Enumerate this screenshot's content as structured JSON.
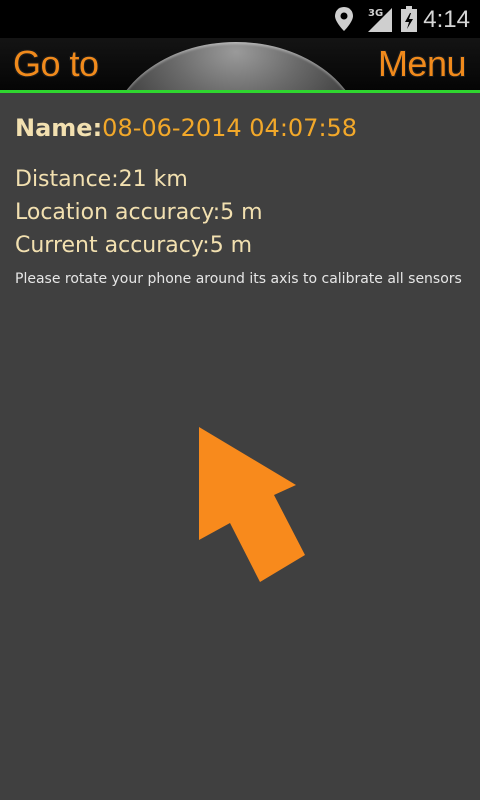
{
  "status_bar": {
    "time": "4:14",
    "network_label": "3G",
    "icons": [
      "location-icon",
      "signal-icon",
      "battery-icon"
    ]
  },
  "action_bar": {
    "goto_label": "Go to",
    "menu_label": "Menu"
  },
  "info": {
    "name_label": "Name:",
    "name_value": "08-06-2014 04:07:58",
    "distance": "Distance:21 km",
    "location_accuracy": "Location accuracy:5 m",
    "current_accuracy": "Current accuracy:5 m",
    "hint": "Please rotate your phone around its axis to calibrate all sensors"
  },
  "arrow": {
    "icon": "direction-arrow-icon",
    "color": "#f88a1c"
  },
  "colors": {
    "accent": "#f08a1c",
    "divider": "#2fd62f",
    "background": "#404040"
  }
}
